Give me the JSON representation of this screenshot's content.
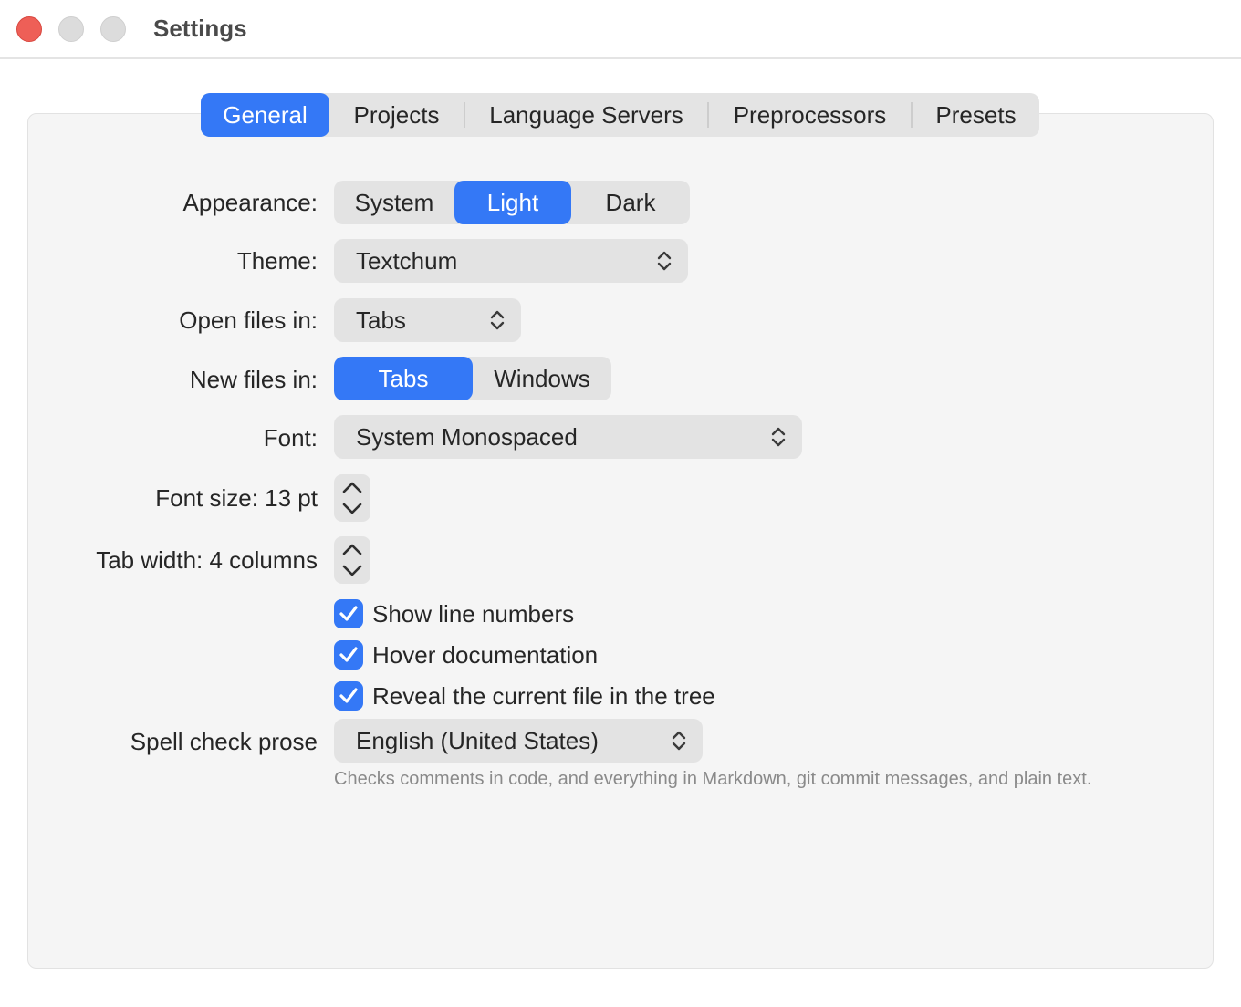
{
  "window": {
    "title": "Settings"
  },
  "tabs": [
    {
      "label": "General",
      "active": true
    },
    {
      "label": "Projects",
      "active": false
    },
    {
      "label": "Language Servers",
      "active": false
    },
    {
      "label": "Preprocessors",
      "active": false
    },
    {
      "label": "Presets",
      "active": false
    }
  ],
  "appearance": {
    "label": "Appearance:",
    "options": [
      "System",
      "Light",
      "Dark"
    ],
    "selected": "Light"
  },
  "theme": {
    "label": "Theme:",
    "value": "Textchum"
  },
  "open_files": {
    "label": "Open files in:",
    "value": "Tabs"
  },
  "new_files": {
    "label": "New files in:",
    "options": [
      "Tabs",
      "Windows"
    ],
    "selected": "Tabs"
  },
  "font": {
    "label": "Font:",
    "value": "System Monospaced"
  },
  "font_size": {
    "label": "Font size: 13 pt"
  },
  "tab_width": {
    "label": "Tab width: 4 columns"
  },
  "checkboxes": [
    {
      "label": "Show line numbers",
      "checked": true
    },
    {
      "label": "Hover documentation",
      "checked": true
    },
    {
      "label": "Reveal the current file in the tree",
      "checked": true
    }
  ],
  "spell_check": {
    "label": "Spell check prose",
    "value": "English (United States)",
    "hint": "Checks comments in code, and everything in Markdown, git commit messages, and plain text."
  },
  "colors": {
    "accent": "#3478f6",
    "close": "#ee5f57"
  }
}
